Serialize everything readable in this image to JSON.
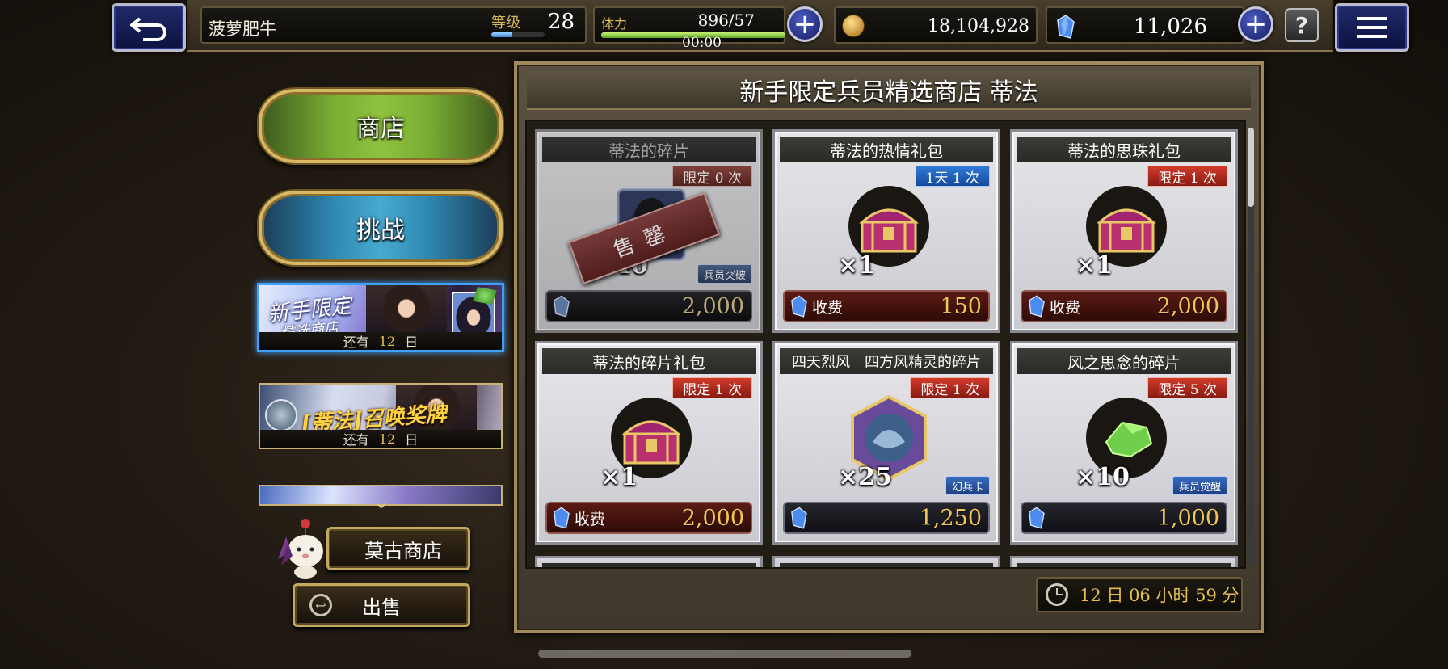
{
  "header": {
    "player_name": "菠萝肥牛",
    "level_label": "等级",
    "level": "28",
    "level_progress": 0.4,
    "stamina_label": "体力",
    "stamina": "896/57",
    "stamina_timer": "00:00",
    "stamina_progress": 1.0,
    "gil": "18,104,928",
    "gems": "11,026",
    "help": "?"
  },
  "sidebar": {
    "shop": "商店",
    "challenge": "挑战",
    "banners": [
      {
        "title": "新手限定",
        "subtitle": "精选商店",
        "remaining_prefix": "还有",
        "remaining_days": "12",
        "remaining_suffix": "日"
      },
      {
        "title": "[蒂法]召唤奖牌",
        "remaining_prefix": "还有",
        "remaining_days": "12",
        "remaining_suffix": "日"
      }
    ],
    "moogle_shop": "莫古商店",
    "sell": "出售"
  },
  "shop": {
    "title": "新手限定兵员精选商店 蒂法",
    "timer": "12 日 06 小时 59 分",
    "items": [
      {
        "name": "蒂法的碎片",
        "limit": "限定 0 次",
        "qty": "×40",
        "tag": "兵员突破",
        "pay": "",
        "price": "2,000",
        "sold_out": "售罄"
      },
      {
        "name": "蒂法的热情礼包",
        "limit": "1天 1 次",
        "qty": "×1",
        "pay": "收费",
        "price": "150"
      },
      {
        "name": "蒂法的思珠礼包",
        "limit": "限定 1 次",
        "qty": "×1",
        "pay": "收费",
        "price": "2,000"
      },
      {
        "name": "蒂法的碎片礼包",
        "limit": "限定 1 次",
        "qty": "×1",
        "pay": "收费",
        "price": "2,000"
      },
      {
        "name": "四天烈风　四方风精灵的碎片",
        "limit": "限定 1 次",
        "qty": "×25",
        "tag": "幻兵卡",
        "pay": "",
        "price": "1,250"
      },
      {
        "name": "风之思念的碎片",
        "limit": "限定 5 次",
        "qty": "×10",
        "tag": "兵员觉醒",
        "pay": "",
        "price": "1,000"
      }
    ]
  },
  "colors": {
    "accent_gold": "#f0c557",
    "limit_red": "#d13b2a",
    "limit_blue": "#2f7ad8",
    "selection_blue": "#3fa0ff"
  }
}
